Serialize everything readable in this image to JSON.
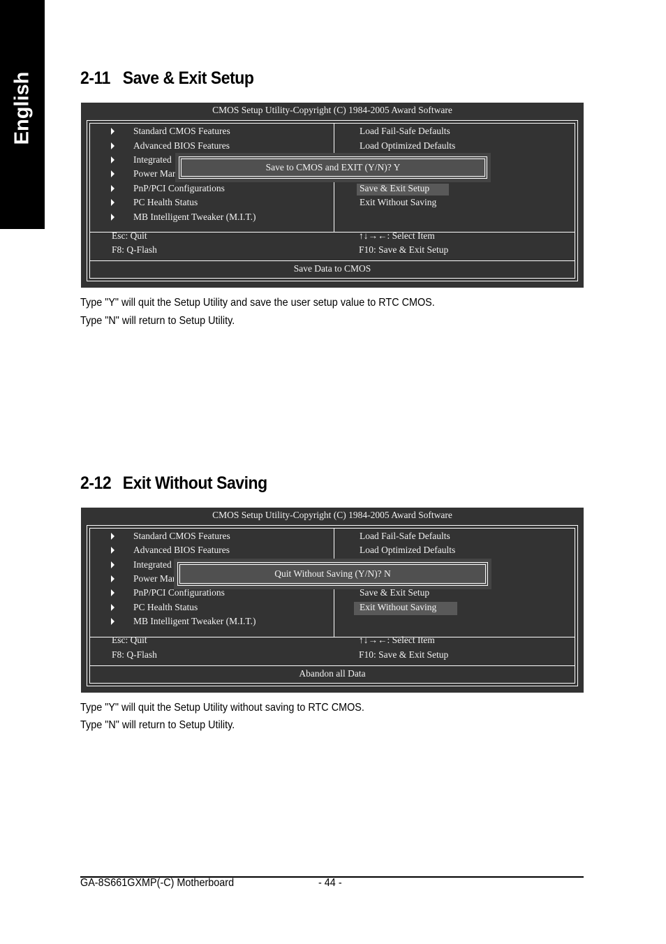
{
  "side_tab": {
    "label": "English"
  },
  "sections": [
    {
      "number": "2-11",
      "title": "Save & Exit Setup",
      "bios": {
        "header": "CMOS Setup Utility-Copyright (C) 1984-2005 Award Software",
        "left_items": [
          "Standard CMOS Features",
          "Advanced BIOS Features",
          "Integrated",
          "Power Mar",
          "PnP/PCI Configurations",
          "PC Health Status",
          "MB Intelligent Tweaker (M.I.T.)"
        ],
        "right_items": [
          "Load Fail-Safe Defaults",
          "Load Optimized Defaults",
          "Save & Exit Setup",
          "Exit Without Saving"
        ],
        "selected_item": "Save & Exit Setup",
        "dialog": "Save to CMOS and EXIT (Y/N)? Y",
        "keys": {
          "esc": "Esc: Quit",
          "f8": "F8: Q-Flash",
          "arrows": "↑↓→←: Select Item",
          "f10": "F10: Save & Exit Setup"
        },
        "status": "Save Data to CMOS"
      },
      "description": [
        "Type \"Y\" will quit the Setup Utility and save the user setup value to RTC CMOS.",
        "Type \"N\" will return to Setup Utility."
      ]
    },
    {
      "number": "2-12",
      "title": "Exit Without Saving",
      "bios": {
        "header": "CMOS Setup Utility-Copyright (C) 1984-2005 Award Software",
        "left_items": [
          "Standard CMOS Features",
          "Advanced BIOS Features",
          "Integrated",
          "Power Mar",
          "PnP/PCI Configurations",
          "PC Health Status",
          "MB Intelligent Tweaker (M.I.T.)"
        ],
        "right_items": [
          "Load Fail-Safe Defaults",
          "Load Optimized Defaults",
          "Save & Exit Setup",
          "Exit Without Saving"
        ],
        "selected_item": "Exit Without Saving",
        "dialog": "Quit Without Saving (Y/N)? N",
        "keys": {
          "esc": "Esc: Quit",
          "f8": "F8: Q-Flash",
          "arrows": "↑↓→←: Select Item",
          "f10": "F10: Save & Exit Setup"
        },
        "status": "Abandon all Data"
      },
      "description": [
        "Type \"Y\" will quit the Setup Utility without saving to RTC CMOS.",
        "Type \"N\" will return to Setup Utility."
      ]
    }
  ],
  "footer": {
    "product": "GA-8S661GXMP(-C) Motherboard",
    "page": "- 44 -"
  }
}
